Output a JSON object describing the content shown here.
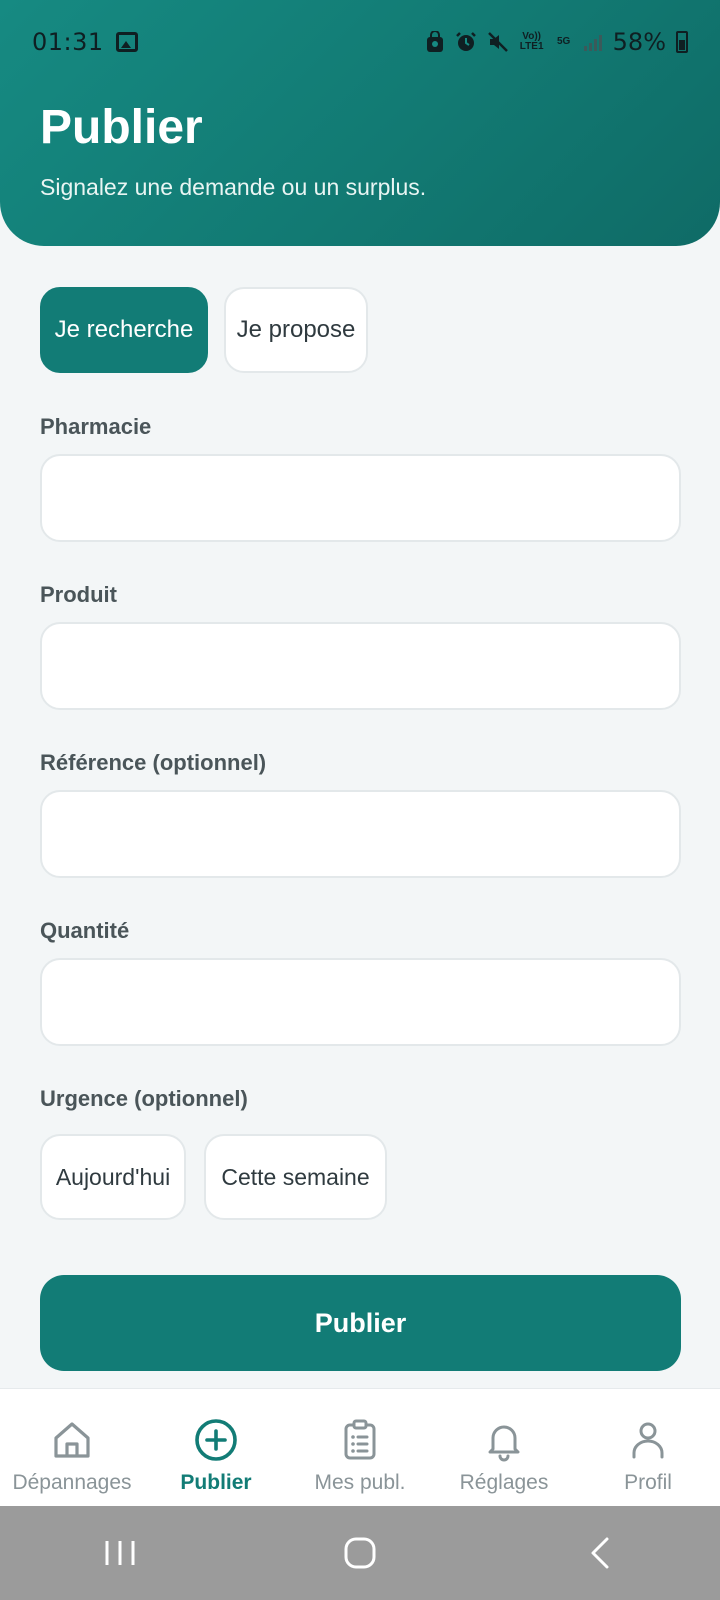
{
  "status_bar": {
    "time": "01:31",
    "volte_label": "Vo)) LTE1",
    "network_label": "5G",
    "battery_percent": "58%",
    "battery_level": 0.58
  },
  "header": {
    "title": "Publier",
    "subtitle": "Signalez une demande ou un surplus."
  },
  "mode_toggle": {
    "options": [
      "Je recherche",
      "Je propose"
    ],
    "selected": "Je recherche"
  },
  "form": {
    "pharmacy": {
      "label": "Pharmacie",
      "value": ""
    },
    "product": {
      "label": "Produit",
      "value": ""
    },
    "reference": {
      "label": "Référence (optionnel)",
      "value": ""
    },
    "quantity": {
      "label": "Quantité",
      "value": ""
    },
    "urgency": {
      "label": "Urgence (optionnel)",
      "options": [
        "Aujourd'hui",
        "Cette semaine"
      ]
    },
    "submit_label": "Publier"
  },
  "bottom_nav": {
    "items": [
      {
        "label": "Dépannages",
        "icon": "home-icon"
      },
      {
        "label": "Publier",
        "icon": "plus-circle-icon"
      },
      {
        "label": "Mes publ.",
        "icon": "clipboard-list-icon"
      },
      {
        "label": "Réglages",
        "icon": "bell-icon"
      },
      {
        "label": "Profil",
        "icon": "user-icon"
      }
    ],
    "active": "Publier"
  },
  "colors": {
    "primary": "#127c76",
    "header_gradient_start": "#168a82",
    "header_gradient_end": "#0f6b66",
    "background": "#f3f6f7",
    "inactive_nav": "#8a9498"
  }
}
